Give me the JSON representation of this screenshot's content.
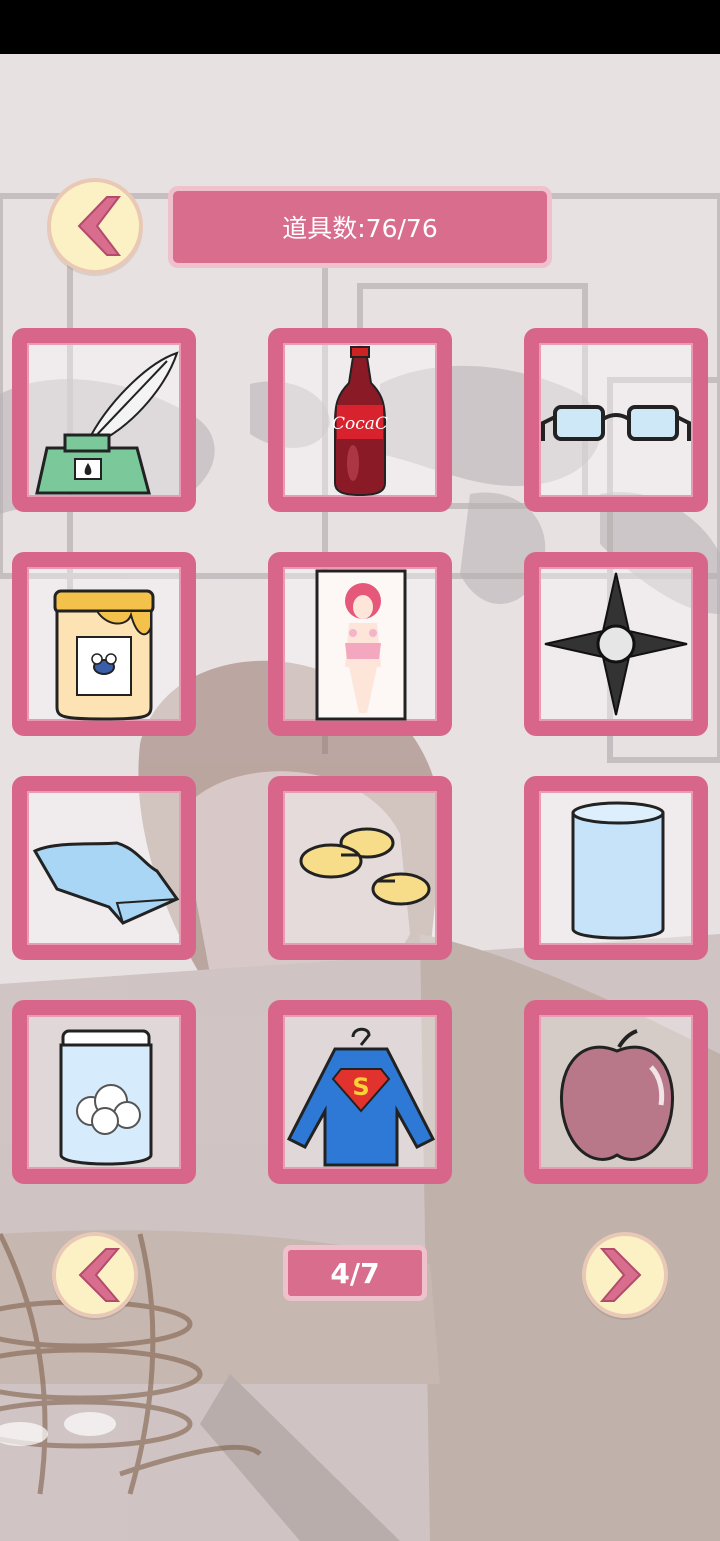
{
  "header": {
    "back_icon": "chevron-left-icon",
    "counter_text": "道具数:76/76"
  },
  "items": [
    {
      "name": "quill-inkwell"
    },
    {
      "name": "cola-bottle",
      "label": "CocaC"
    },
    {
      "name": "glasses"
    },
    {
      "name": "honey-jar"
    },
    {
      "name": "anime-body-pillow"
    },
    {
      "name": "shuriken"
    },
    {
      "name": "blue-cloth"
    },
    {
      "name": "yellow-pills"
    },
    {
      "name": "glass-cup"
    },
    {
      "name": "jar-cotton"
    },
    {
      "name": "superman-shirt",
      "label": "S"
    },
    {
      "name": "apple"
    }
  ],
  "pagination": {
    "prev_icon": "chevron-left-icon",
    "next_icon": "chevron-right-icon",
    "page_text": "4/7"
  },
  "colors": {
    "accent": "#d96d8e",
    "frame": "#d8668a",
    "button_fill": "#fbf1c4"
  }
}
